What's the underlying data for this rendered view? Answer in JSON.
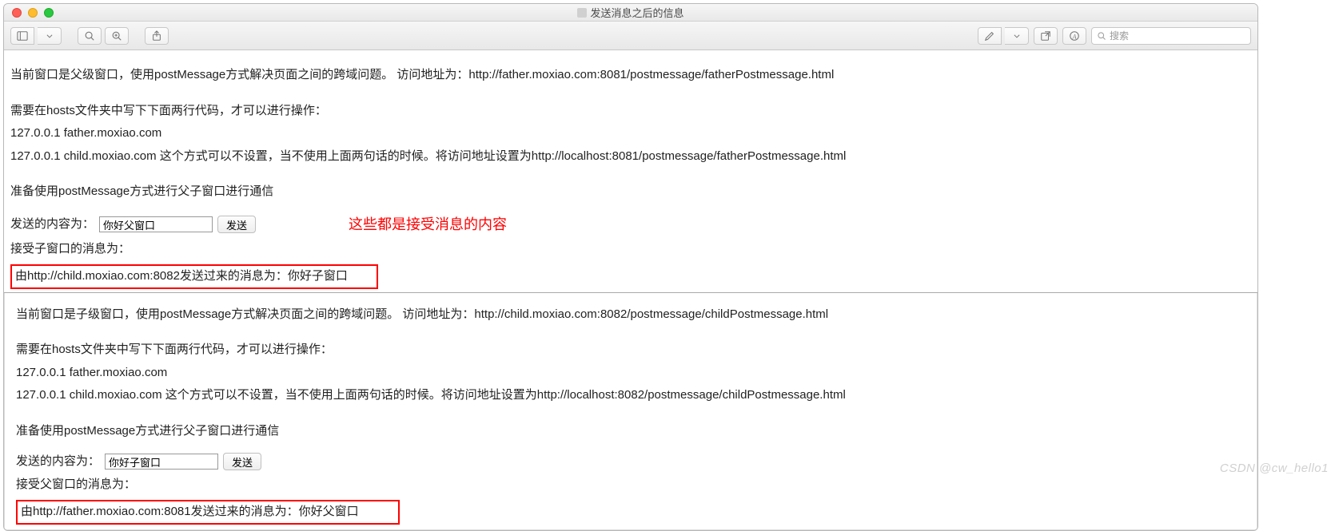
{
  "window": {
    "title": "发送消息之后的信息"
  },
  "toolbar": {
    "search_placeholder": "搜索"
  },
  "annotation": "这些都是接受消息的内容",
  "father": {
    "intro": "当前窗口是父级窗口，使用postMessage方式解决页面之间的跨域问题。 访问地址为：http://father.moxiao.com:8081/postmessage/fatherPostmessage.html",
    "hosts_note": "需要在hosts文件夹中写下下面两行代码，才可以进行操作：",
    "host1": "127.0.0.1 father.moxiao.com",
    "host2": "127.0.0.1 child.moxiao.com 这个方式可以不设置，当不使用上面两句话的时候。将访问地址设置为http://localhost:8081/postmessage/fatherPostmessage.html",
    "prepare": "准备使用postMessage方式进行父子窗口进行通信",
    "send_label": "发送的内容为：",
    "input_value": "你好父窗口",
    "send_btn": "发送",
    "recv_label": "接受子窗口的消息为：",
    "recv_msg": "由http://child.moxiao.com:8082发送过来的消息为：你好子窗口"
  },
  "child": {
    "intro": "当前窗口是子级窗口，使用postMessage方式解决页面之间的跨域问题。 访问地址为：http://child.moxiao.com:8082/postmessage/childPostmessage.html",
    "hosts_note": "需要在hosts文件夹中写下下面两行代码，才可以进行操作：",
    "host1": "127.0.0.1 father.moxiao.com",
    "host2": "127.0.0.1 child.moxiao.com 这个方式可以不设置，当不使用上面两句话的时候。将访问地址设置为http://localhost:8082/postmessage/childPostmessage.html",
    "prepare": "准备使用postMessage方式进行父子窗口进行通信",
    "send_label": "发送的内容为：",
    "input_value": "你好子窗口",
    "send_btn": "发送",
    "recv_label": "接受父窗口的消息为：",
    "recv_msg": "由http://father.moxiao.com:8081发送过来的消息为：你好父窗口"
  },
  "watermark": "CSDN @cw_hello1"
}
